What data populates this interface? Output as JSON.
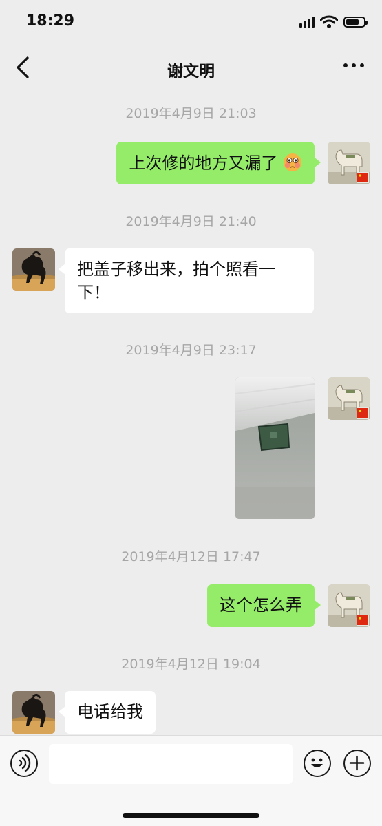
{
  "status_bar": {
    "time": "18:29"
  },
  "header": {
    "title": "谢文明"
  },
  "messages": [
    {
      "timestamp": "2019年4月9日 21:03",
      "sender": "me",
      "text": "上次修的地方又漏了",
      "emoji": "flushed-face"
    },
    {
      "timestamp": "2019年4月9日 21:40",
      "sender": "contact",
      "text_line1": "把盖子移出来，拍个照看一",
      "text_line2": "下！"
    },
    {
      "timestamp": "2019年4月9日 23:17",
      "sender": "me",
      "type": "image"
    },
    {
      "timestamp": "2019年4月12日 17:47",
      "sender": "me",
      "text": "这个怎么弄"
    },
    {
      "timestamp": "2019年4月12日 19:04",
      "sender": "contact",
      "text": "电话给我"
    }
  ],
  "input": {
    "value": "",
    "placeholder": ""
  },
  "colors": {
    "outgoing_bubble": "#95ec69",
    "incoming_bubble": "#ffffff",
    "background": "#ededed",
    "timestamp": "#a6a6a6"
  }
}
